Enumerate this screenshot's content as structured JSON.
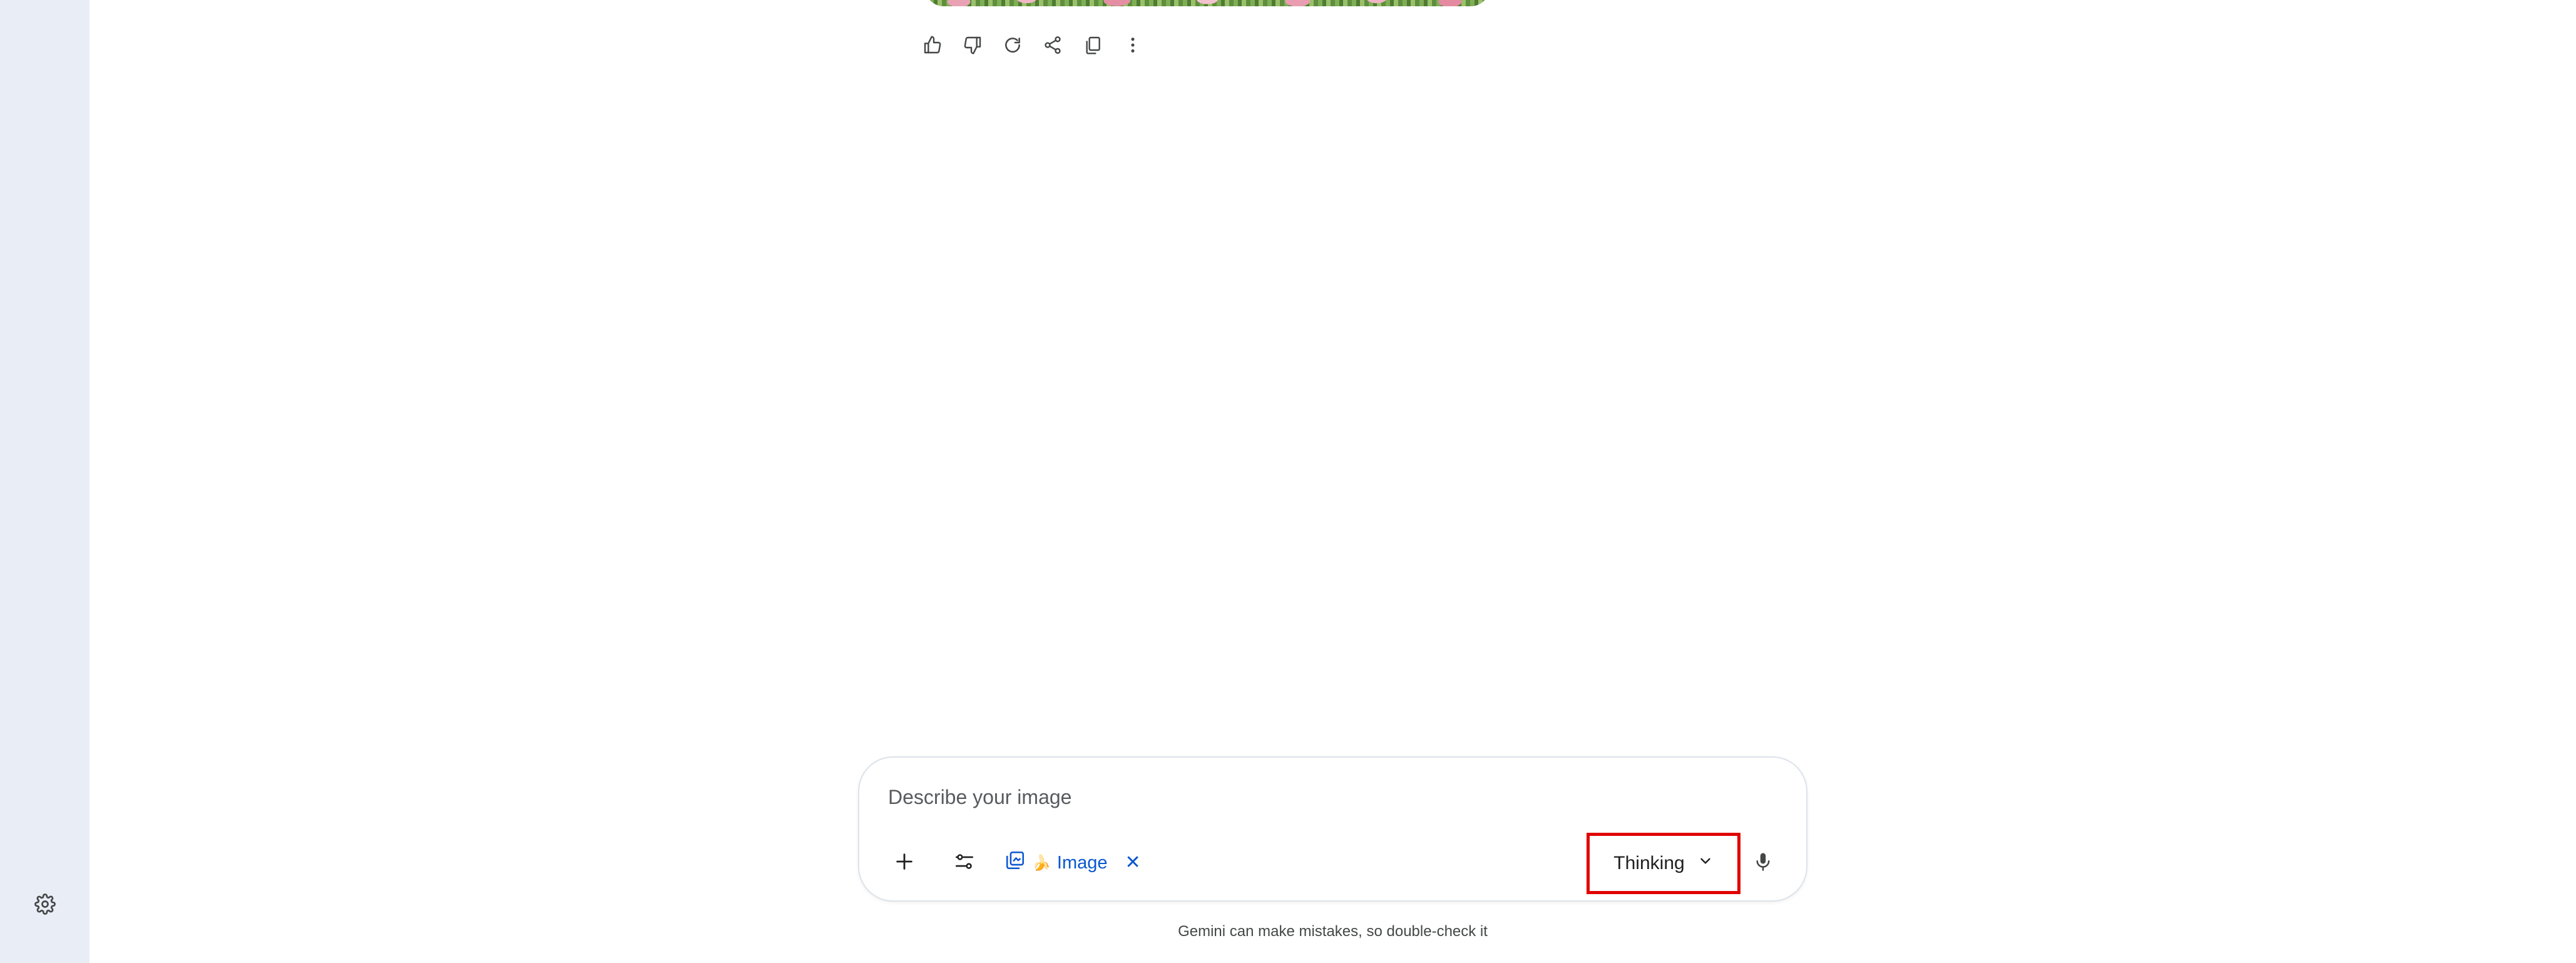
{
  "sidebar": {
    "settings_icon": "gear-icon"
  },
  "response": {
    "image_description": "",
    "actions": [
      {
        "name": "thumbs-up-icon",
        "icon": "thumbs-up-icon"
      },
      {
        "name": "thumbs-down-icon",
        "icon": "thumbs-down-icon"
      },
      {
        "name": "redo-icon",
        "icon": "refresh-icon"
      },
      {
        "name": "share-icon",
        "icon": "share-icon"
      },
      {
        "name": "copy-icon",
        "icon": "copy-icon"
      },
      {
        "name": "more-options-icon",
        "icon": "more-vert-icon"
      }
    ]
  },
  "composer": {
    "placeholder": "Describe your image",
    "value": "",
    "add_icon": "plus-icon",
    "tools_icon": "tune-icon",
    "image_chip": {
      "emoji": "🍌",
      "label": "Image",
      "remove_symbol": "✕"
    },
    "mode_select": {
      "label": "Thinking",
      "chevron": "chevron-down-icon",
      "highlight_color": "#e00000"
    },
    "mic_icon": "microphone-icon"
  },
  "footer": {
    "disclaimer": "Gemini can make mistakes, so double-check it"
  },
  "colors": {
    "sidebar_bg": "#e9edf6",
    "accent_blue": "#0b57d0",
    "icon_gray": "#444746"
  }
}
